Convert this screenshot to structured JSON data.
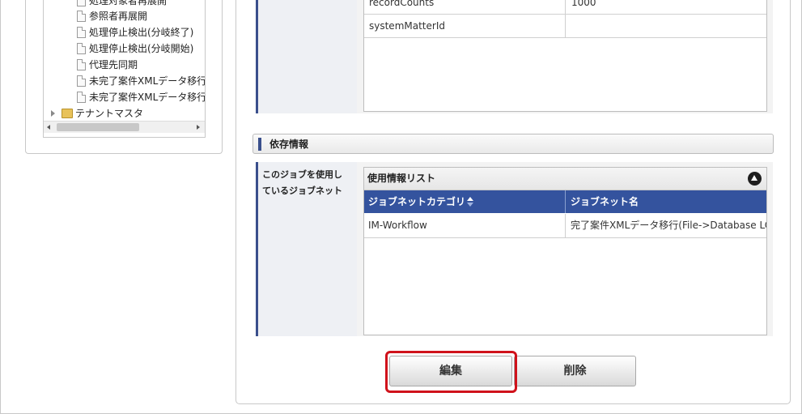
{
  "tree": {
    "items": [
      {
        "label": "処理対象者再展開",
        "icon": "document-icon"
      },
      {
        "label": "参照者再展開",
        "icon": "document-icon"
      },
      {
        "label": "処理停止検出(分岐終了)",
        "icon": "document-icon"
      },
      {
        "label": "処理停止検出(分岐開始)",
        "icon": "document-icon"
      },
      {
        "label": "代理先同期",
        "icon": "document-icon"
      },
      {
        "label": "未完了案件XMLデータ移行",
        "icon": "document-icon"
      },
      {
        "label": "未完了案件XMLデータ移行",
        "icon": "document-icon"
      }
    ],
    "folder": {
      "label": "テナントマスタ",
      "icon": "folder-icon"
    }
  },
  "parameters": {
    "rows": [
      {
        "name": "recordCounts",
        "value": "1000"
      },
      {
        "name": "systemMatterId",
        "value": ""
      }
    ]
  },
  "dependency": {
    "section_title": "依存情報",
    "row_label": "このジョブを使用しているジョブネット",
    "grid": {
      "caption": "使用情報リスト",
      "columns": [
        "ジョブネットカテゴリ",
        "ジョブネット名"
      ],
      "rows": [
        {
          "category": "IM-Workflow",
          "name": "完了案件XMLデータ移行(File->Database LOB"
        }
      ]
    }
  },
  "actions": {
    "edit_label": "編集",
    "delete_label": "削除"
  },
  "colors": {
    "accent": "#3a4f8c",
    "grid_header": "#34539e",
    "highlight": "#d0121b"
  }
}
